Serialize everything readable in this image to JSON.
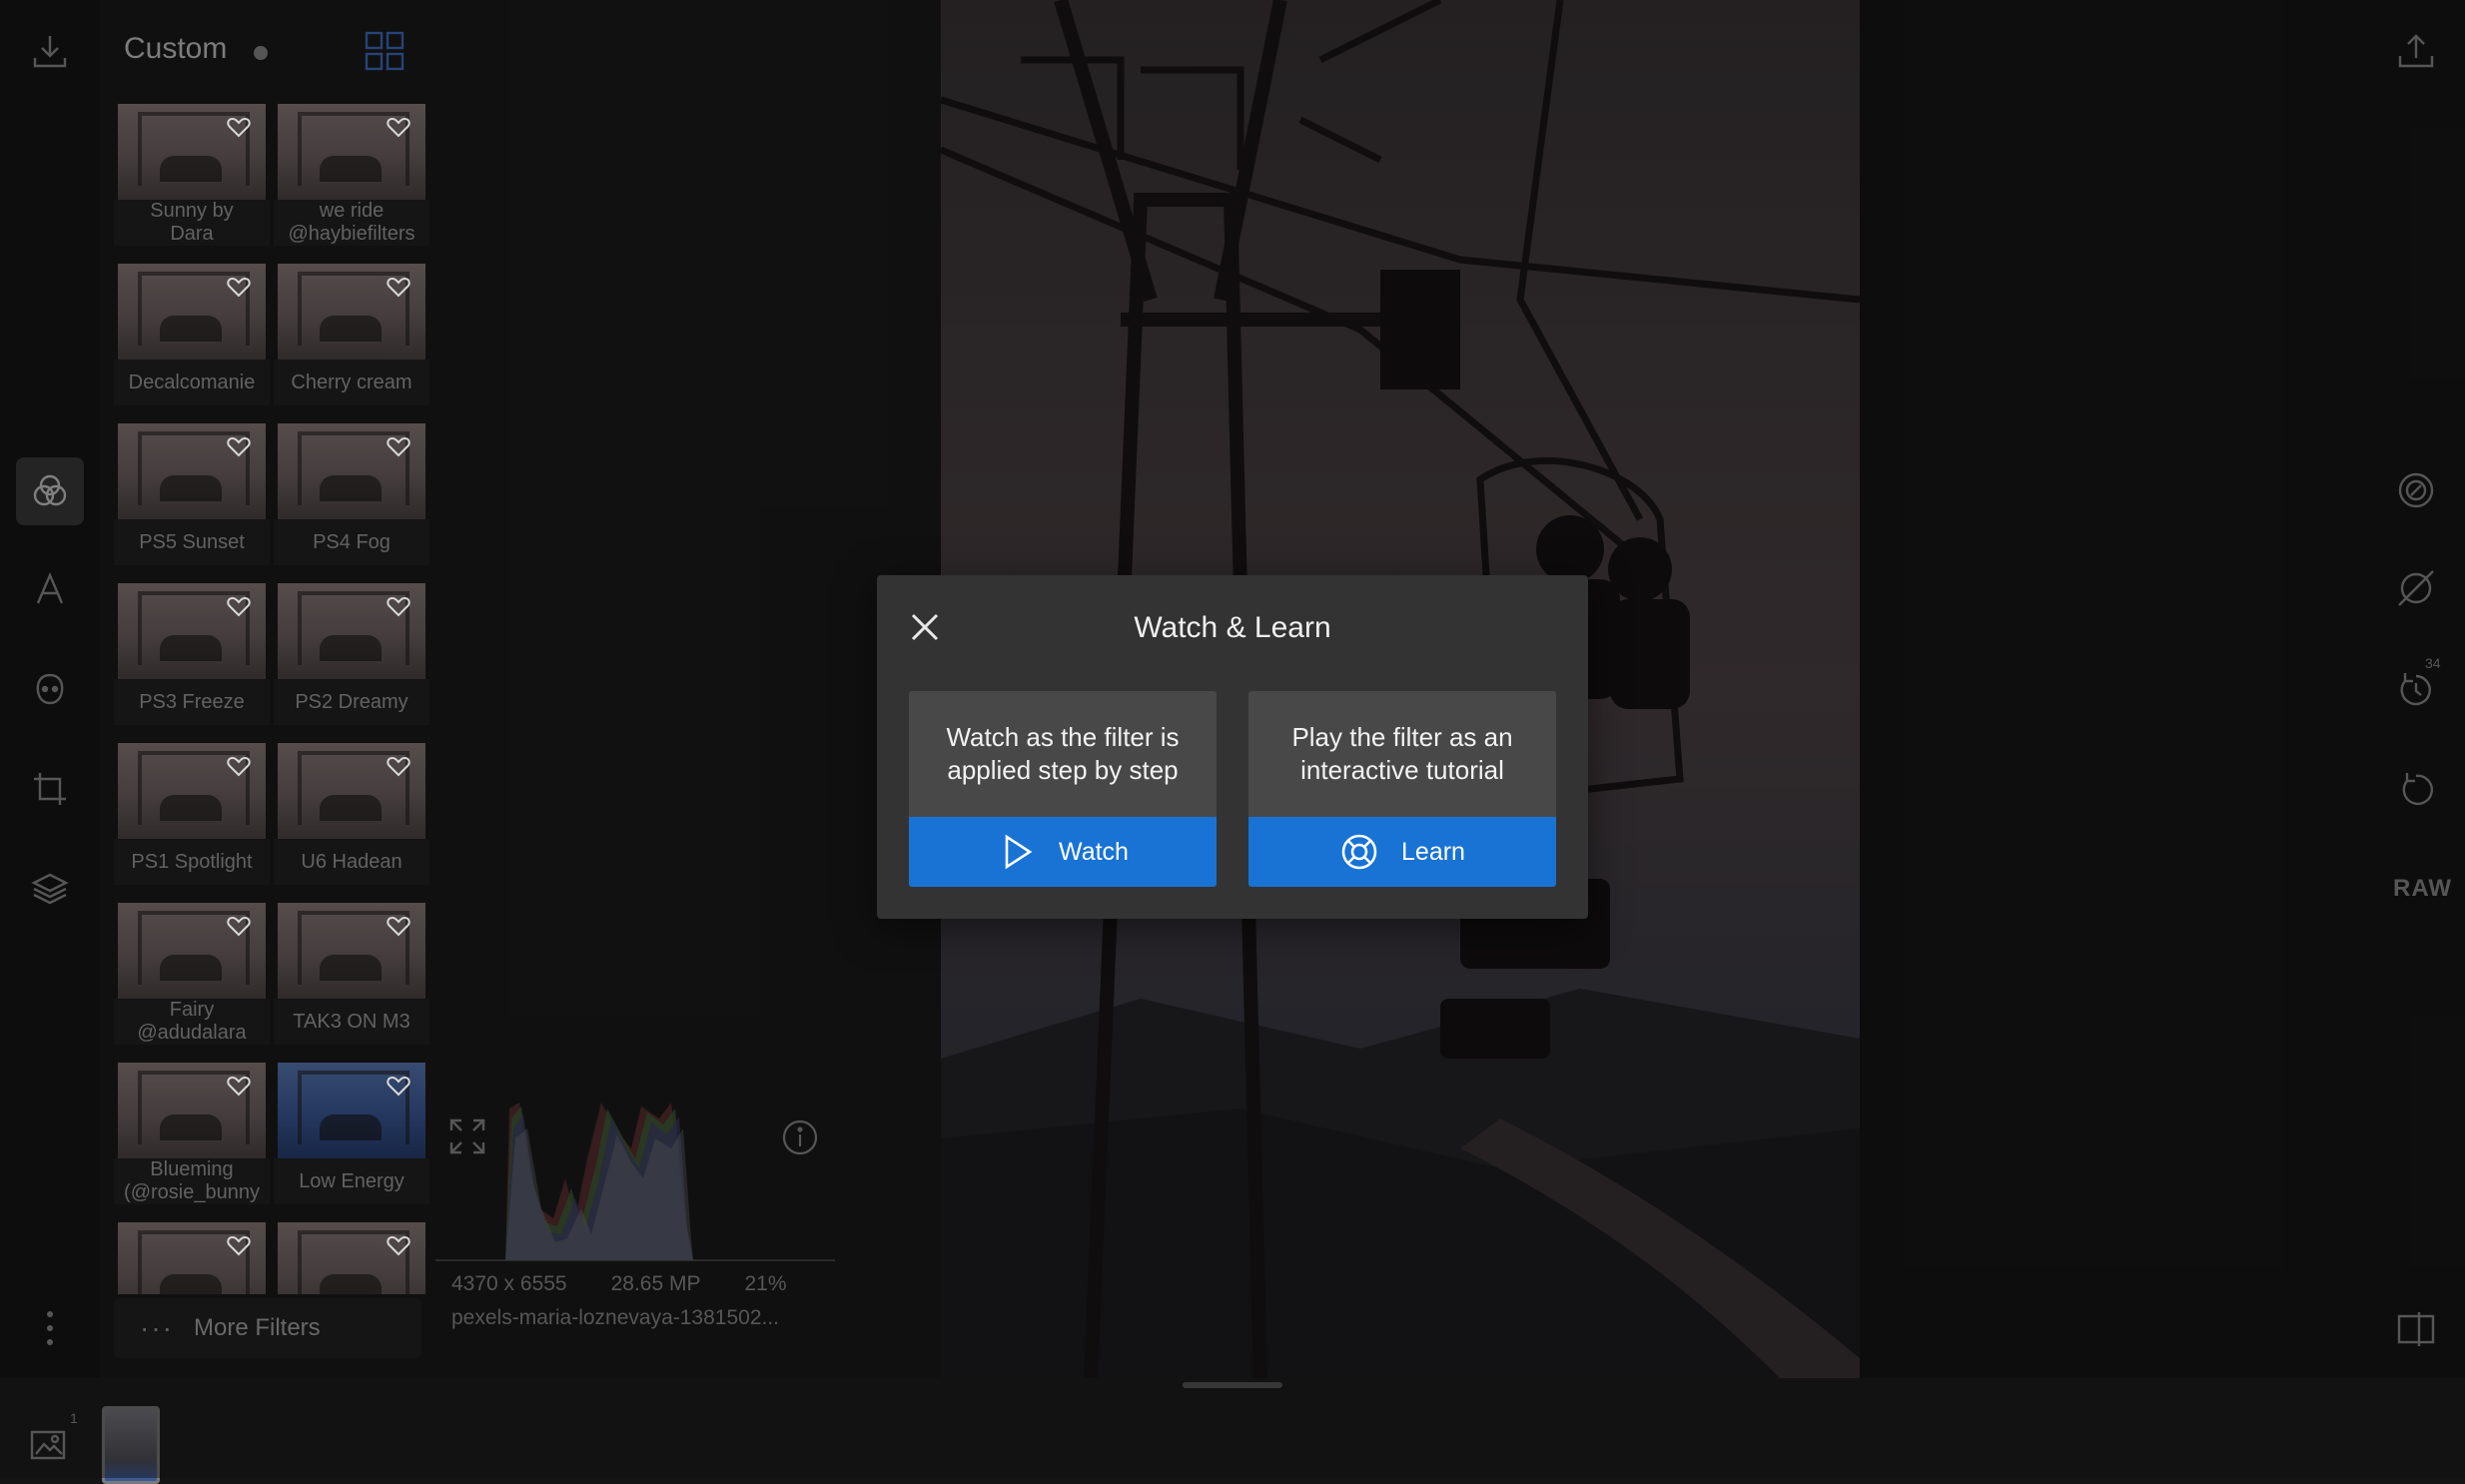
{
  "panel": {
    "title": "Custom",
    "filters": [
      {
        "name": "Sunny by\nDara"
      },
      {
        "name": "we ride\n@haybiefilters"
      },
      {
        "name": "Decalcomanie"
      },
      {
        "name": "Cherry cream"
      },
      {
        "name": "PS5 Sunset"
      },
      {
        "name": "PS4 Fog"
      },
      {
        "name": "PS3 Freeze"
      },
      {
        "name": "PS2 Dreamy"
      },
      {
        "name": "PS1 Spotlight"
      },
      {
        "name": "U6 Hadean"
      },
      {
        "name": "Fairy\n@adudalara"
      },
      {
        "name": "TAK3 ON M3"
      },
      {
        "name": "Blueming\n(@rosie_bunny"
      },
      {
        "name": "Low Energy"
      },
      {
        "name": ""
      },
      {
        "name": ""
      }
    ],
    "more_filters": "More Filters",
    "more_dots": "···"
  },
  "image_info": {
    "dimensions": "4370 x 6555",
    "megapixels": "28.65 MP",
    "zoom": "21%",
    "filename": "pexels-maria-loznevaya-1381502..."
  },
  "right_rail": {
    "history_count": "34",
    "raw_label": "RAW"
  },
  "filmstrip": {
    "image_count": "1"
  },
  "dialog": {
    "title": "Watch & Learn",
    "watch_description": "Watch as the filter is applied step by step",
    "watch_button": "Watch",
    "learn_description": "Play the filter as an interactive tutorial",
    "learn_button": "Learn"
  },
  "colors": {
    "accent": "#1873d5",
    "dialog_bg": "#333333",
    "card_bg": "#484848"
  }
}
